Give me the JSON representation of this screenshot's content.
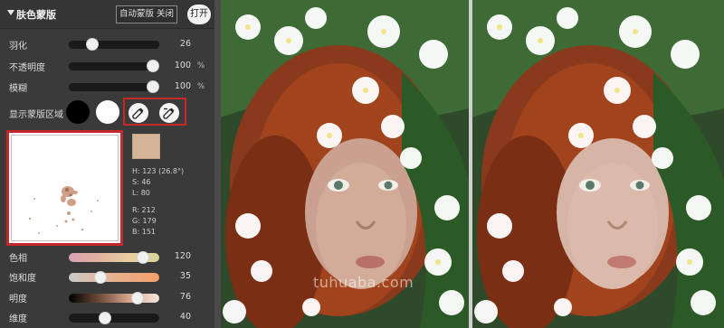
{
  "panel": {
    "title": "肤色蒙版",
    "auto_mask_label": "自动蒙版 关闭",
    "open_label": "打开"
  },
  "sliders": [
    {
      "label": "羽化",
      "value": "26",
      "unit": "",
      "level": 0.26
    },
    {
      "label": "不透明度",
      "value": "100",
      "unit": "%",
      "level": 1.0
    },
    {
      "label": "模糊",
      "value": "100",
      "unit": "%",
      "level": 1.0
    }
  ],
  "mask_display": {
    "label": "显示蒙版区域"
  },
  "sample": {
    "color": "#d4b397",
    "h": "H: 123 (26.8°)",
    "s": "S:  46",
    "l": "L:  80",
    "r": "R: 212",
    "g": "G: 179",
    "b": "B: 151"
  },
  "color_sliders": [
    {
      "label": "色相",
      "value": "120",
      "level": 0.82,
      "gradient": "linear-gradient(90deg,#d9a2b4,#e1b29f,#e8cfa1,#d8d59a)"
    },
    {
      "label": "饱和度",
      "value": "35",
      "level": 0.35,
      "gradient": "linear-gradient(90deg,#c9c9c9,#e8b18f,#f3a06a)"
    },
    {
      "label": "明度",
      "value": "76",
      "level": 0.76,
      "gradient": "linear-gradient(90deg,#000000,#6b4a3a,#d9a58b,#f5e6da)"
    },
    {
      "label": "维度",
      "value": "40",
      "level": 0.4,
      "gradient": "linear-gradient(90deg,#1a1a1a,#1a1a1a)"
    }
  ],
  "watermark": "tuhuaba.com",
  "colors": {
    "highlight_red": "#c62828",
    "panel_bg": "#3a3a3a"
  }
}
